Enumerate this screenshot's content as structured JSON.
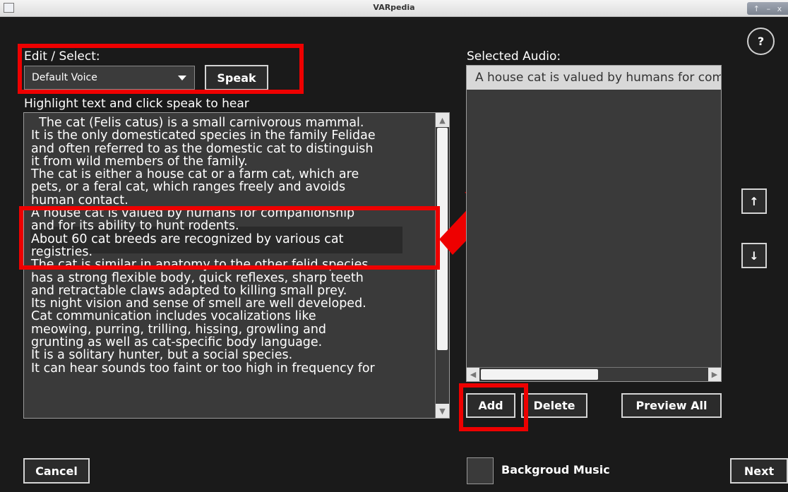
{
  "window": {
    "title": "VARpedia",
    "controls": [
      "↑",
      "–",
      "x"
    ]
  },
  "help": {
    "label": "?"
  },
  "edit": {
    "label": "Edit / Select:",
    "voice_selected": "Default Voice",
    "speak_label": "Speak",
    "hint": "Highlight text and click speak to hear"
  },
  "text_area": {
    "content": "  The cat (Felis catus) is a small carnivorous mammal.\nIt is the only domesticated species in the family Felidae\nand often referred to as the domestic cat to distinguish\nit from wild members of the family.\nThe cat is either a house cat or a farm cat, which are\npets, or a feral cat, which ranges freely and avoids\nhuman contact.\nA house cat is valued by humans for companionship\nand for its ability to hunt rodents.\nAbout 60 cat breeds are recognized by various cat\nregistries.\nThe cat is similar in anatomy to the other felid species,\nhas a strong flexible body, quick reflexes, sharp teeth\nand retractable claws adapted to killing small prey.\nIts night vision and sense of smell are well developed.\nCat communication includes vocalizations like\nmeowing, purring, trilling, hissing, growling and\ngrunting as well as cat-specific body language.\nIt is a solitary hunter, but a social species.\nIt can hear sounds too faint or too high in frequency for"
  },
  "audio": {
    "label": "Selected Audio:",
    "items": [
      "A house cat is valued by humans for companionship and for its ability to hunt rodents."
    ],
    "add_label": "Add",
    "delete_label": "Delete",
    "preview_label": "Preview All",
    "up_label": "↑",
    "down_label": "↓"
  },
  "footer": {
    "cancel_label": "Cancel",
    "music_label": "Backgroud Music",
    "next_label": "Next"
  },
  "colors": {
    "background": "#1a1a1a",
    "panel": "#3a3a3a",
    "highlight_box": "#ee0000",
    "selected_item": "#d8d8d8"
  }
}
